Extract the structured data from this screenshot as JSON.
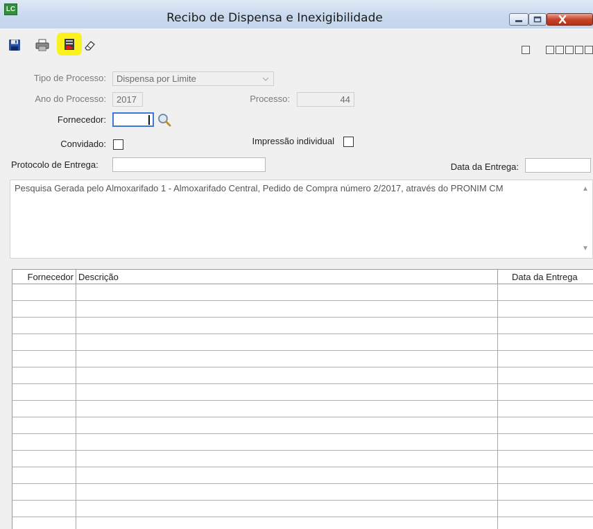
{
  "window": {
    "app_icon_text": "LC",
    "title": "Recibo de Dispensa e Inexigibilidade"
  },
  "toolbar": {
    "tools": [
      {
        "name": "save",
        "icon": "floppy-disk-icon"
      },
      {
        "name": "print",
        "icon": "printer-icon"
      },
      {
        "name": "generate",
        "icon": "report-generate-icon",
        "highlighted": true,
        "highlight_color": "#f9f21d"
      },
      {
        "name": "clear",
        "icon": "eraser-icon"
      }
    ]
  },
  "form": {
    "tipo_processo": {
      "label": "Tipo de Processo:",
      "value": "Dispensa por Limite",
      "enabled": false
    },
    "ano_processo": {
      "label": "Ano do Processo:",
      "value": "2017",
      "enabled": false
    },
    "processo": {
      "label": "Processo:",
      "value": "44",
      "enabled": false
    },
    "fornecedor": {
      "label": "Fornecedor:",
      "value": ""
    },
    "convidado": {
      "label": "Convidado:",
      "checked": false
    },
    "impressao_individual": {
      "label": "Impressão individual",
      "checked": false
    },
    "protocolo_entrega": {
      "label": "Protocolo de Entrega:",
      "value": ""
    },
    "data_entrega": {
      "label": "Data da Entrega:",
      "value": ""
    },
    "descricao": "Pesquisa Gerada pelo Almoxarifado 1 - Almoxarifado Central, Pedido de Compra número 2/2017, através do PRONIM CM"
  },
  "grid": {
    "columns": [
      "Fornecedor",
      "Descrição",
      "Data da Entrega"
    ],
    "rows": []
  },
  "colors": {
    "highlight": "#f9f21d",
    "close_button": "#c7442a",
    "titlebar": "#c9d9ee"
  }
}
